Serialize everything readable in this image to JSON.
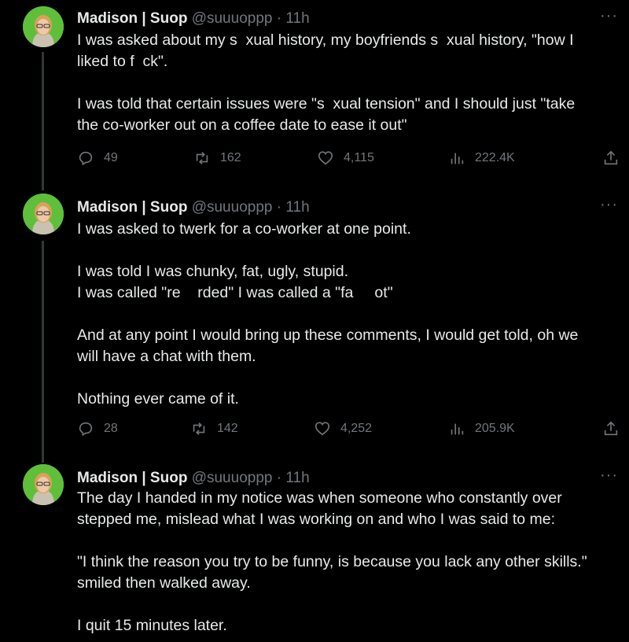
{
  "tweets": [
    {
      "name": "Madison | Suop",
      "handle": "@suuuoppp · 11h",
      "more": "···",
      "lines": [
        "I was asked about my s  xual history, my boyfriends s  xual history, \"how I",
        "liked to f  ck\".",
        "",
        "I was told that certain issues were \"s  xual tension\" and I should just \"take",
        "the co-worker out on a coffee date to ease it out\""
      ],
      "replies": "49",
      "reposts": "162",
      "likes": "4,115",
      "views": "222.4K"
    },
    {
      "name": "Madison | Suop",
      "handle": "@suuuoppp · 11h",
      "more": "···",
      "lines": [
        "I was asked to twerk for a co-worker at one point.",
        "",
        "I was told I was chunky, fat, ugly, stupid.",
        "I was called \"re    rded\" I was called a \"fa     ot\"",
        "",
        "And at any point I would bring up these comments, I would get told, oh we",
        "will have a chat with them.",
        "",
        "Nothing ever came of it."
      ],
      "replies": "28",
      "reposts": "142",
      "likes": "4,252",
      "views": "205.9K"
    },
    {
      "name": "Madison | Suop",
      "handle": "@suuuoppp · 11h",
      "more": "···",
      "lines": [
        "The day I handed in my notice was when someone who constantly over",
        "stepped me, mislead what I was working on and who I was said to me:",
        "",
        "\"I think the reason you try to be funny, is because you lack any other skills.\"",
        "smiled then walked away.",
        "",
        "I quit 15 minutes later."
      ]
    }
  ],
  "colors": {
    "background": "#000000",
    "text": "#e7e9ea",
    "muted": "#71767b",
    "thread_line": "#333639",
    "avatar_bg": "#5fbf3a"
  },
  "icons": [
    "reply-icon",
    "repost-icon",
    "like-icon",
    "views-icon",
    "share-icon",
    "more-icon"
  ]
}
